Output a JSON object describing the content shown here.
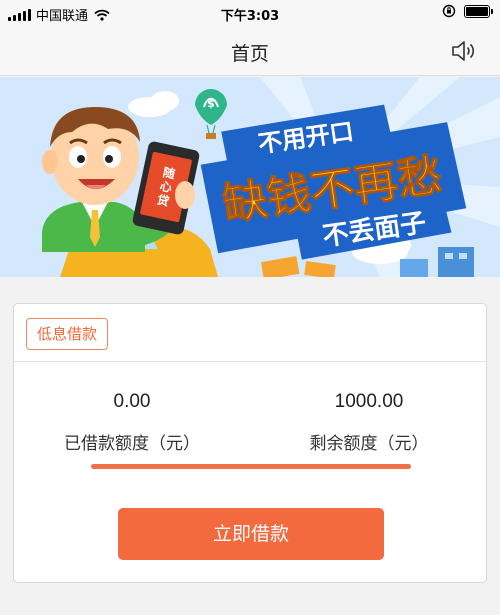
{
  "status_bar": {
    "carrier": "中国联通",
    "time": "下午3:03",
    "battery_level": 1.0
  },
  "nav": {
    "title": "首页",
    "right_icon": "speaker-icon"
  },
  "banner": {
    "line1": "不用开口",
    "line2": "缺钱不再愁",
    "line3": "不丢面子",
    "phone_text": "随心贷"
  },
  "loan_card": {
    "tag": "低息借款",
    "borrowed_amount": "0.00",
    "borrowed_label": "已借款额度（元）",
    "remaining_amount": "1000.00",
    "remaining_label": "剩余额度（元）",
    "remaining_fraction": 1.0,
    "button_label": "立即借款"
  },
  "colors": {
    "accent": "#f26a3d",
    "tag_border": "#f08a5d"
  }
}
